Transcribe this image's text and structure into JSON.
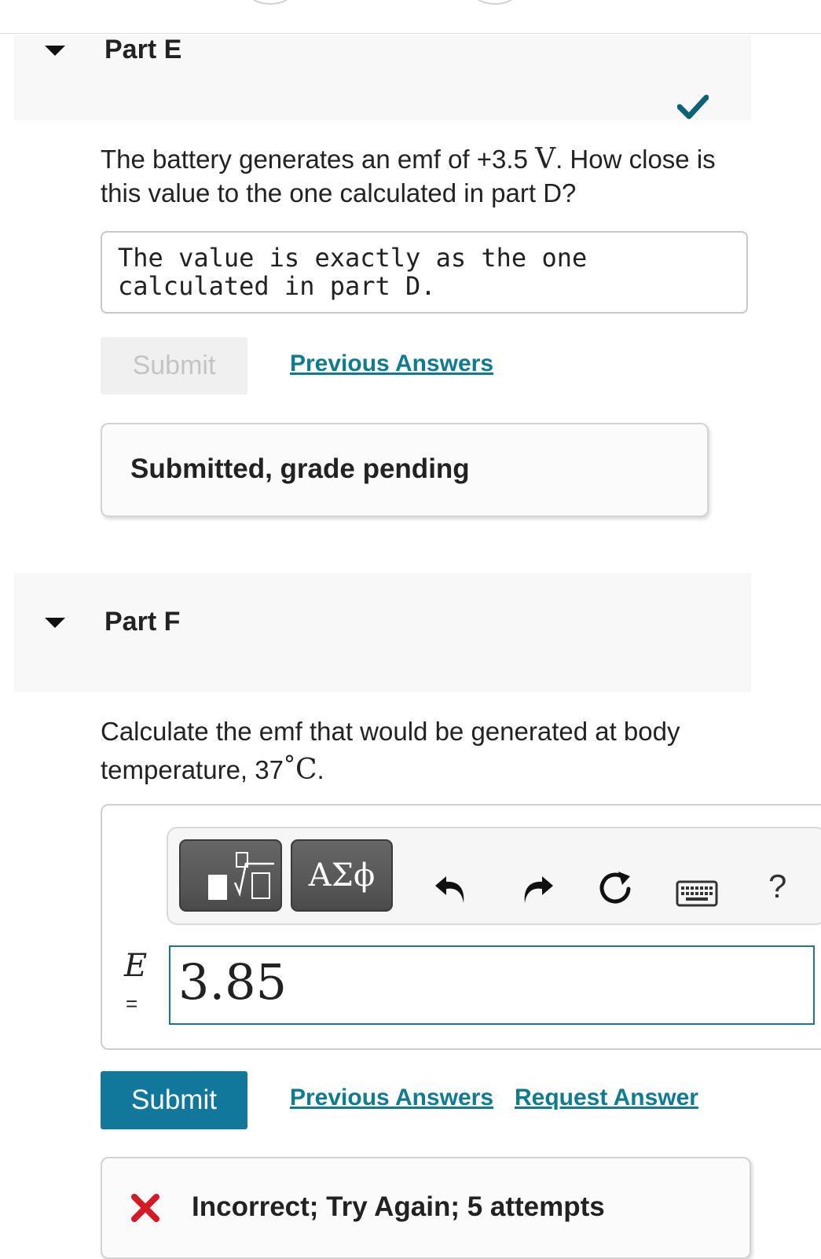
{
  "part_e": {
    "title": "Part E",
    "question_before": "The battery generates an emf of +3.5 ",
    "question_unit": "V",
    "question_after": ". How close is this value to the one calculated in part D?",
    "answer_text": "The value is exactly as the one calculated in part D.",
    "submit_label": "Submit",
    "previous_answers_label": "Previous Answers",
    "feedback": "Submitted, grade pending",
    "status_icon": "checkmark-icon"
  },
  "part_f": {
    "title": "Part F",
    "question_before": "Calculate the emf that would be generated at body temperature, 37",
    "question_degree": "°",
    "question_unit": "C",
    "question_after": ".",
    "toolbar": {
      "template_button": "templates-icon",
      "greek_label": "ΑΣϕ",
      "icons": [
        "undo-icon",
        "redo-icon",
        "reset-icon",
        "keyboard-icon",
        "help-icon"
      ],
      "help_label": "?"
    },
    "variable": "E",
    "equals": "=",
    "input_value": "3.85",
    "submit_label": "Submit",
    "previous_answers_label": "Previous Answers",
    "request_answer_label": "Request Answer",
    "feedback": "Incorrect; Try Again; 5 attempts"
  },
  "colors": {
    "link": "#0f7b8e",
    "primary_button": "#11789b",
    "check": "#0d6275",
    "error": "#d41a24"
  }
}
